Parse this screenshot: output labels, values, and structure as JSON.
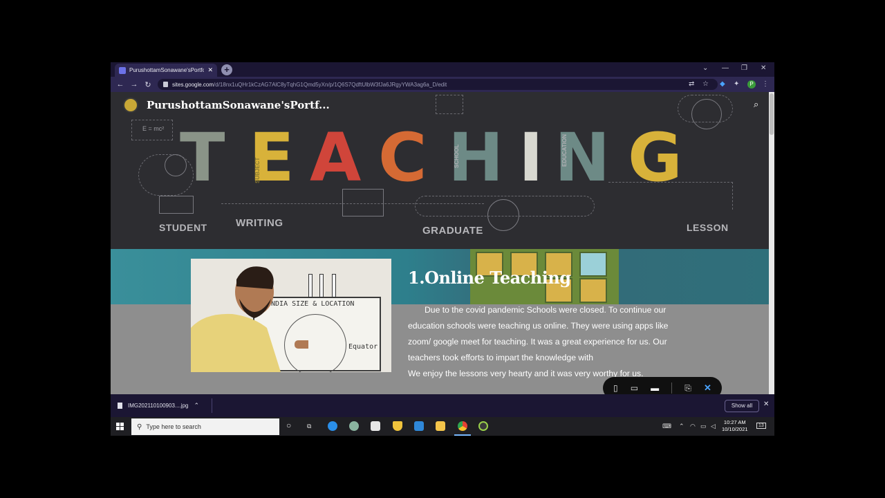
{
  "browser": {
    "tab_title": "PurushottamSonawane'sPortfolio",
    "url_host": "sites.google.com",
    "url_path": "/d/18nx1uQHr1kCzAG7AlC8yTqhG1Qmd5yXn/p/1Q6S7QdftUlbW3fJa6JRgyYWA3ag6a_D/edit"
  },
  "site": {
    "title": "PurushottamSonawane'sPortf..."
  },
  "hero": {
    "letters": [
      {
        "char": "T",
        "color": "#8a9488"
      },
      {
        "char": "E",
        "color": "#d8b23a"
      },
      {
        "char": "A",
        "color": "#d0453a"
      },
      {
        "char": "C",
        "color": "#d56a34"
      },
      {
        "char": "H",
        "color": "#6d8a86"
      },
      {
        "char": "I",
        "color": "#d8d8d0"
      },
      {
        "char": "N",
        "color": "#6d8a86"
      },
      {
        "char": "G",
        "color": "#d8b23a"
      }
    ],
    "labels": {
      "student": "STUDENT",
      "writing": "WRITING",
      "graduate": "GRADUATE",
      "lesson": "LESSON",
      "school": "SCHOOL",
      "education": "EDUCATION",
      "subject": "SUBJECT",
      "formula": "E = mc²"
    }
  },
  "section": {
    "title": "1.Online Teaching",
    "paragraph": "Due to the covid pandemic Schools were closed. To continue our education schools were teaching us online. They were using apps like zoom/ google meet for teaching. It was a  great experience for us. Our teachers took efforts to impart the knowledge with",
    "paragraph_end": "We  enjoy the lessons very hearty and it was very worthy for us."
  },
  "whiteboard": {
    "line1": "INDIA SIZE & LOCATION",
    "line2": "Equator"
  },
  "downloads": {
    "file_name": "IMG202110100903....jpg",
    "show_all": "Show all"
  },
  "taskbar": {
    "search_placeholder": "Type here to search",
    "time": "10:27 AM",
    "date": "10/10/2021",
    "notification_count": "13"
  },
  "profile_initial": "P"
}
